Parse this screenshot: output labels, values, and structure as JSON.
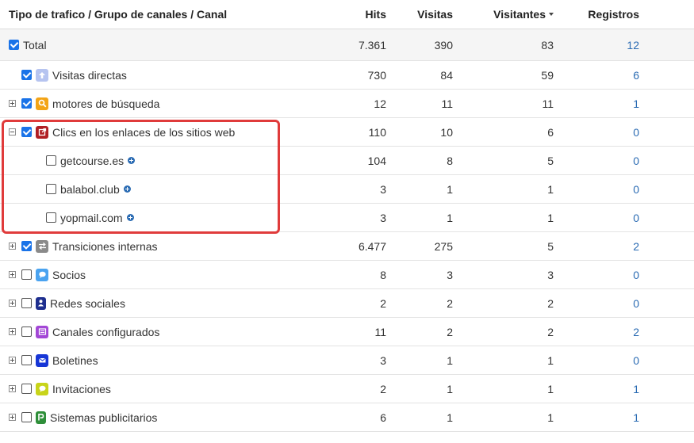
{
  "header": {
    "name": "Tipo de trafico / Grupo de canales / Canal",
    "hits": "Hits",
    "visits": "Visitas",
    "visitors": "Visitantes",
    "registrations": "Registros"
  },
  "colors": {
    "link": "#2a6bb3",
    "highlight": "#e03b3b",
    "checkbox": "#1a73e8"
  },
  "rows": [
    {
      "label": "Total",
      "hits": "7.361",
      "visits": "390",
      "visitors": "83",
      "registrations": "12",
      "checked": true,
      "icon": ""
    },
    {
      "label": "Visitas directas",
      "hits": "730",
      "visits": "84",
      "visitors": "59",
      "registrations": "6",
      "checked": true,
      "icon": "arrow-up-icon",
      "icon_color": "#b6c4f0"
    },
    {
      "label": "motores de búsqueda",
      "hits": "12",
      "visits": "11",
      "visitors": "11",
      "registrations": "1",
      "checked": true,
      "icon": "search-icon",
      "icon_color": "#f3a417"
    },
    {
      "label": "Clics en los enlaces de los sitios web",
      "hits": "110",
      "visits": "10",
      "visitors": "6",
      "registrations": "0",
      "checked": true,
      "icon": "external-link-icon",
      "icon_color": "#b01f24"
    },
    {
      "label": "getcourse.es",
      "hits": "104",
      "visits": "8",
      "visitors": "5",
      "registrations": "0",
      "checked": false
    },
    {
      "label": "balabol.club",
      "hits": "3",
      "visits": "1",
      "visitors": "1",
      "registrations": "0",
      "checked": false
    },
    {
      "label": "yopmail.com",
      "hits": "3",
      "visits": "1",
      "visitors": "1",
      "registrations": "0",
      "checked": false
    },
    {
      "label": "Transiciones internas",
      "hits": "6.477",
      "visits": "275",
      "visitors": "5",
      "registrations": "2",
      "checked": true,
      "icon": "swap-icon",
      "icon_color": "#8a8a8a"
    },
    {
      "label": "Socios",
      "hits": "8",
      "visits": "3",
      "visitors": "3",
      "registrations": "0",
      "checked": false,
      "icon": "chat-bubble-icon",
      "icon_color": "#4aa3f0"
    },
    {
      "label": "Redes sociales",
      "hits": "2",
      "visits": "2",
      "visitors": "2",
      "registrations": "0",
      "checked": false,
      "icon": "person-icon",
      "icon_color": "#1f2f8f"
    },
    {
      "label": "Canales configurados",
      "hits": "11",
      "visits": "2",
      "visitors": "2",
      "registrations": "2",
      "checked": false,
      "icon": "list-icon",
      "icon_color": "#a347d6"
    },
    {
      "label": "Boletines",
      "hits": "3",
      "visits": "1",
      "visitors": "1",
      "registrations": "0",
      "checked": false,
      "icon": "mail-icon",
      "icon_color": "#1736d6"
    },
    {
      "label": "Invitaciones",
      "hits": "2",
      "visits": "1",
      "visitors": "1",
      "registrations": "1",
      "checked": false,
      "icon": "speech-icon",
      "icon_color": "#c8d41a"
    },
    {
      "label": "Sistemas publicitarios",
      "hits": "6",
      "visits": "1",
      "visitors": "1",
      "registrations": "1",
      "checked": false,
      "icon": "ad-icon",
      "icon_color": "#2f8f3a"
    }
  ]
}
